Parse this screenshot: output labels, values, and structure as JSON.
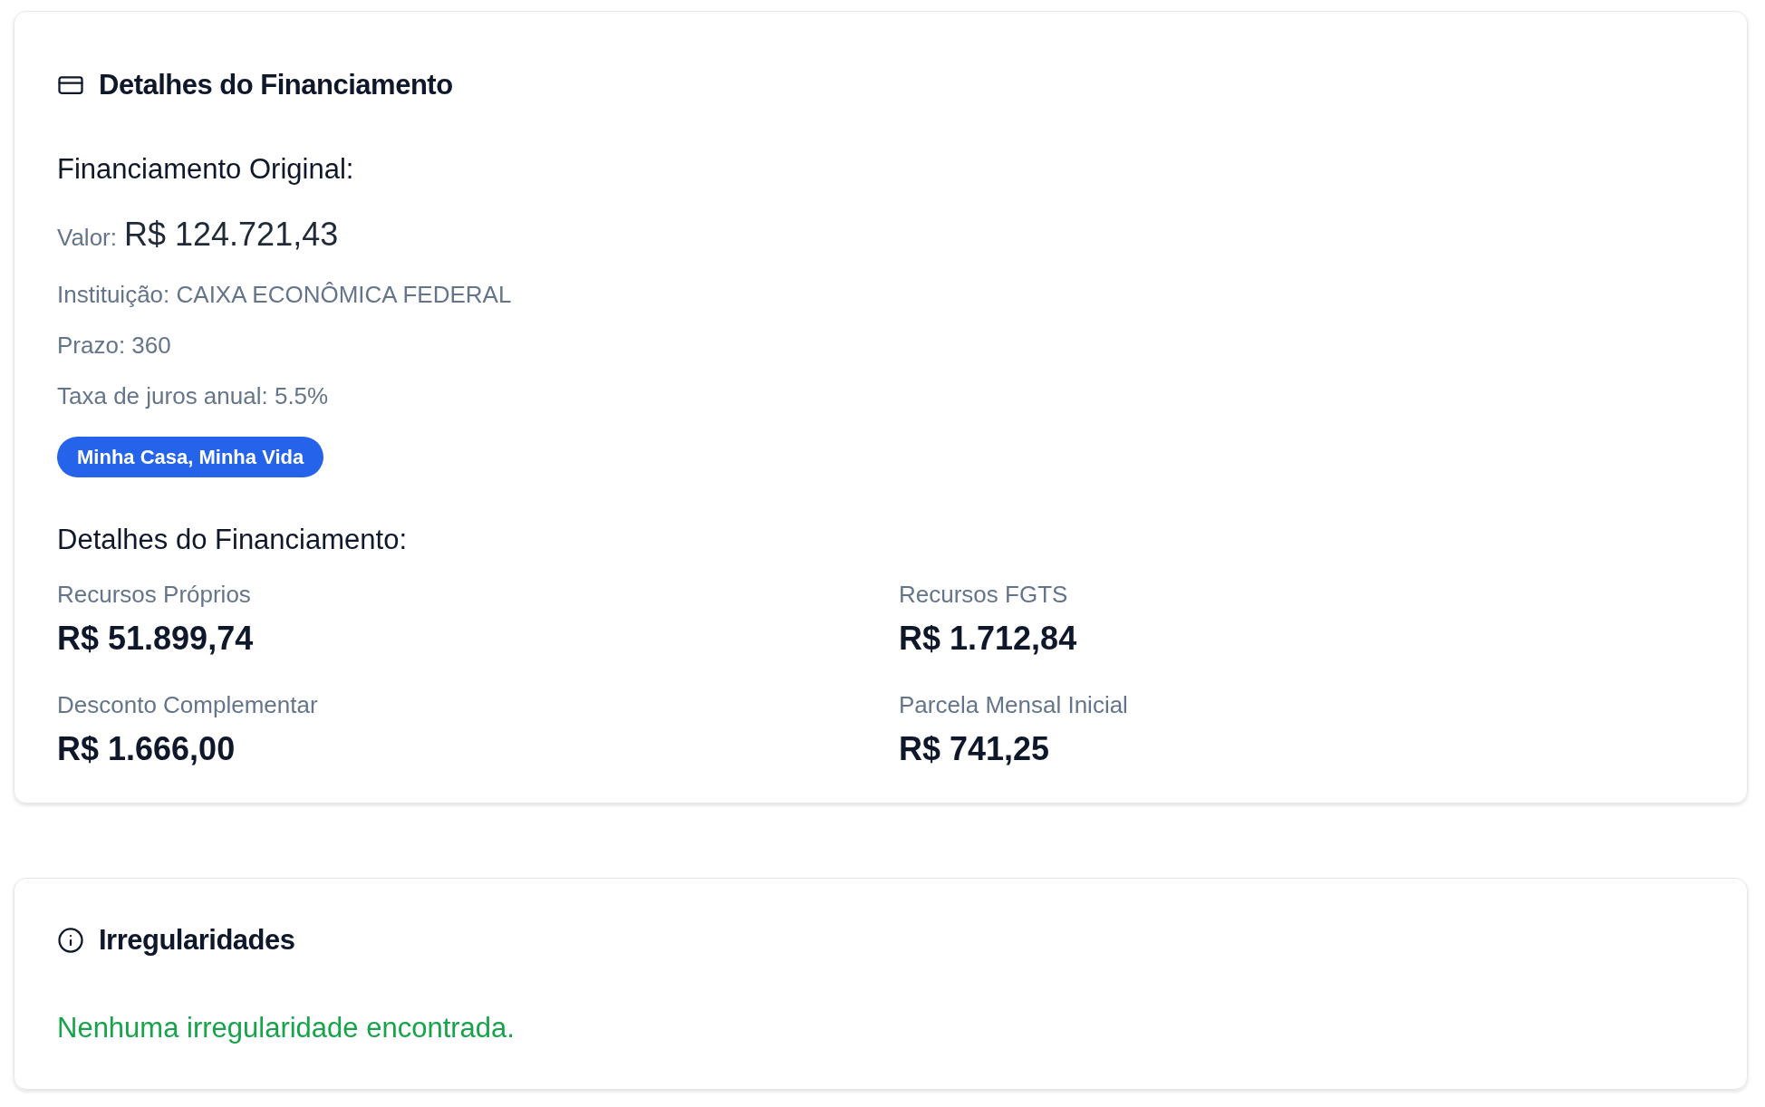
{
  "financing_card": {
    "title": "Detalhes do Financiamento",
    "original": {
      "heading": "Financiamento Original:",
      "value_label": "Valor:",
      "value": "R$ 124.721,43",
      "lines": [
        "Instituição: CAIXA ECONÔMICA FEDERAL",
        "Prazo: 360",
        "Taxa de juros anual: 5.5%"
      ],
      "badge": "Minha Casa, Minha Vida"
    },
    "details": {
      "heading": "Detalhes do Financiamento:",
      "items": [
        {
          "label": "Recursos Próprios",
          "value": "R$ 51.899,74"
        },
        {
          "label": "Recursos FGTS",
          "value": "R$ 1.712,84"
        },
        {
          "label": "Desconto Complementar",
          "value": "R$ 1.666,00"
        },
        {
          "label": "Parcela Mensal Inicial",
          "value": "R$ 741,25"
        }
      ]
    }
  },
  "irregularities_card": {
    "title": "Irregularidades",
    "message": "Nenhuma irregularidade encontrada."
  }
}
